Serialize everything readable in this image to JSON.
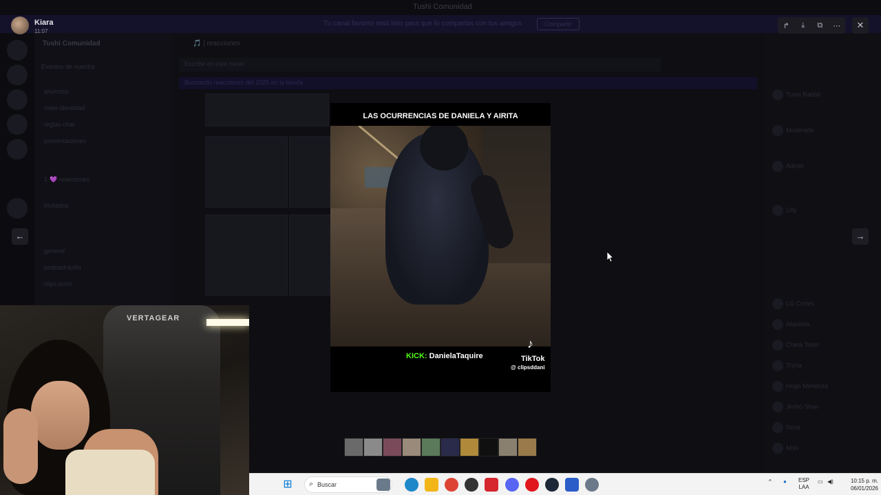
{
  "background": {
    "window_title": "Tushi Comunidad",
    "banner_text": "Tu canal favorito está listo para que lo compartas con tus amigos",
    "banner_button": "Compartir",
    "server_name": "Tushi Comunidad",
    "events_label": "Eventos de nuestra",
    "channels": [
      "anuncios",
      "roles-identidad",
      "reglas-chat",
      "presentaciones",
      "1-💜-reacciones",
      "invitados",
      "general",
      "podcast-tushi",
      "clips-tushi"
    ],
    "channel_header": "🎵 | reacciones",
    "search_placeholder": "Escribe en este canal",
    "sub_banner": "Buscando reacciones del 2025 en la tienda",
    "members": [
      "Tushi Rabbit",
      "Moderado",
      "Admin",
      "Lilly",
      "LG Cortes",
      "Alquimia",
      "Cheta Tolón",
      "Tryna",
      "Hugo Mendoza",
      "Jimbo Shan",
      "Nova",
      "Miss"
    ]
  },
  "viewer": {
    "user_name": "Kiara",
    "user_time": "11:07",
    "tools": [
      "forward-icon",
      "download-icon",
      "open-external-icon",
      "more-icon"
    ],
    "close_icon": "✕",
    "prev_icon": "←",
    "next_icon": "→"
  },
  "media": {
    "title": "LAS OCURRENCIAS DE DANIELA Y AIRITA",
    "kick_prefix": "KICK:",
    "kick_name": "DanielaTaquire",
    "tiktok_logo": "♪",
    "tiktok_label": "TikTok",
    "tiktok_handle": "@ clipsddani",
    "strip_colors": [
      "#6a6a6a",
      "#8a8a8a",
      "#7a4a5a",
      "#9a8a7a",
      "#5a7a5a",
      "#2a2a4a",
      "#b08a3a",
      "#101010",
      "#8a8070",
      "#9a7a4a"
    ]
  },
  "webcam": {
    "chair_brand": "VERTAGEAR"
  },
  "taskbar": {
    "start_icon": "⊞",
    "search_label": "Buscar",
    "search_icon": "⌕",
    "language_top": "ESP",
    "language_bottom": "LAA",
    "time": "10:15 p. m.",
    "date": "06/01/2026",
    "tray_up_icon": "^"
  }
}
